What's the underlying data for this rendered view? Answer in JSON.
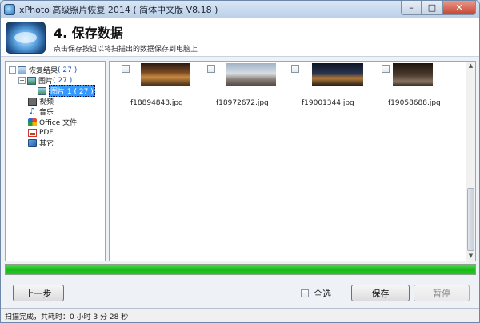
{
  "window": {
    "title": "xPhoto 高级照片恢复 2014 ( 简体中文版 V8.18 )",
    "minimize": "–",
    "maximize": "□",
    "close": "✕"
  },
  "header": {
    "step_title": "4. 保存数据",
    "step_desc": "点击保存按钮以将扫描出的数据保存到电脑上"
  },
  "tree": {
    "root": {
      "label": "恢复结果",
      "count": "( 27 )"
    },
    "images": {
      "label": "图片",
      "count": "( 27 )"
    },
    "images_sub": {
      "label": "图片 1",
      "count": "( 27 )"
    },
    "video": {
      "label": "视频"
    },
    "music": {
      "label": "音乐"
    },
    "office": {
      "label": "Office 文件"
    },
    "pdf": {
      "label": "PDF"
    },
    "other": {
      "label": "其它"
    }
  },
  "files": [
    {
      "name": "f18894848.jpg"
    },
    {
      "name": "f18972672.jpg"
    },
    {
      "name": "f19001344.jpg"
    },
    {
      "name": "f19058688.jpg"
    }
  ],
  "progress": {
    "fraction": 1.0
  },
  "buttons": {
    "prev": "上一步",
    "select_all": "全选",
    "save": "保存",
    "pause": "暂停"
  },
  "status": {
    "text": "扫描完成，共耗时：0 小时 3 分 28 秒"
  },
  "colors": {
    "progress": "#22c922",
    "selection": "#3399ff",
    "count_text": "#1f52b0"
  }
}
